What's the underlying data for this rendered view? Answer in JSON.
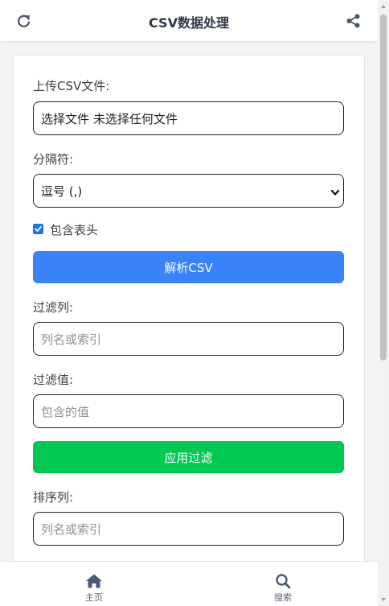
{
  "header": {
    "title": "CSV数据处理",
    "refresh_icon": "refresh-icon",
    "share_icon": "share-icon"
  },
  "form": {
    "upload_label": "上传CSV文件:",
    "file_button": "选择文件",
    "file_status": "未选择任何文件",
    "delimiter_label": "分隔符:",
    "delimiter_value": "逗号 (,)",
    "header_checkbox_label": "包含表头",
    "header_checked": true,
    "parse_button": "解析CSV",
    "filter_column_label": "过滤列:",
    "filter_column_placeholder": "列名或索引",
    "filter_value_label": "过滤值:",
    "filter_value_placeholder": "包含的值",
    "apply_filter_button": "应用过滤",
    "sort_column_label": "排序列:",
    "sort_column_placeholder": "列名或索引"
  },
  "tabbar": {
    "home_label": "主页",
    "search_label": "搜索"
  },
  "colors": {
    "primary_button": "#3a82f7",
    "filter_button": "#00c853",
    "checkbox": "#1a73e8",
    "title": "#2d3748"
  }
}
